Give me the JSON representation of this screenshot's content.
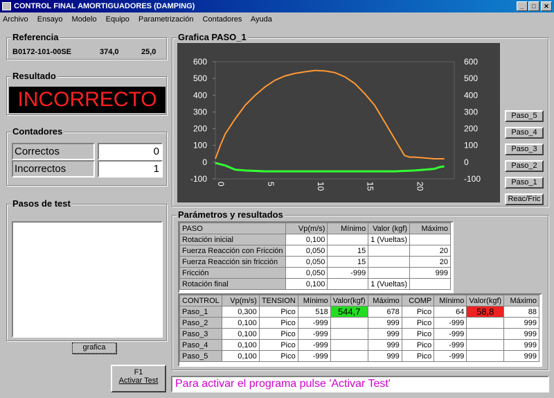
{
  "window": {
    "title": "CONTROL FINAL AMORTIGUADORES (DAMPING)",
    "minimize": "_",
    "maximize": "□",
    "close": "✕"
  },
  "menu": [
    "Archivo",
    "Ensayo",
    "Modelo",
    "Equipo",
    "Parametrización",
    "Contadores",
    "Ayuda"
  ],
  "referencia": {
    "title": "Referencia",
    "code": "B0172-101-00SE",
    "value1": "374,0",
    "value2": "25,0"
  },
  "resultado": {
    "title": "Resultado",
    "text": "INCORRECTO",
    "color": "#ff2020"
  },
  "contadores": {
    "title": "Contadores",
    "rows": [
      {
        "label": "Correctos",
        "value": "0"
      },
      {
        "label": "Incorrectos",
        "value": "1"
      }
    ]
  },
  "pasos": {
    "title": "Pasos de test",
    "grafica_button": "grafica"
  },
  "activar": {
    "key": "F1",
    "label": "Activar Test"
  },
  "status_message": "Para activar el programa pulse 'Activar Test'",
  "grafica": {
    "title": "Grafica PASO_1",
    "buttons": [
      "Paso_5",
      "Paso_4",
      "Paso_3",
      "Paso_2",
      "Paso_1",
      "Reac/Fric"
    ]
  },
  "chart_data": {
    "type": "line",
    "title": "",
    "xlabel": "",
    "ylabel": "",
    "xlim": [
      0,
      24
    ],
    "ylim": [
      -100,
      600
    ],
    "x_ticks": [
      "0",
      "5",
      "10",
      "15",
      "20"
    ],
    "y_ticks": [
      "600",
      "500",
      "400",
      "300",
      "200",
      "100",
      "0",
      "-100"
    ],
    "grid": false,
    "series": [
      {
        "color": "#ff9933",
        "x": [
          0,
          0.5,
          1,
          2,
          3,
          4,
          5,
          6,
          7,
          8,
          9,
          10,
          11,
          12,
          13,
          14,
          15,
          16,
          17,
          18,
          19,
          19.5,
          20,
          21,
          22,
          23
        ],
        "y": [
          20,
          100,
          170,
          260,
          340,
          400,
          450,
          490,
          515,
          530,
          540,
          548,
          545,
          535,
          510,
          470,
          410,
          340,
          240,
          140,
          40,
          30,
          30,
          25,
          20,
          20
        ]
      },
      {
        "color": "#33ff33",
        "x": [
          0,
          1,
          2,
          3,
          5,
          8,
          10,
          13,
          16,
          18,
          20,
          21,
          22,
          22.5,
          23
        ],
        "y": [
          -5,
          -20,
          -45,
          -50,
          -55,
          -55,
          -55,
          -55,
          -55,
          -55,
          -50,
          -45,
          -40,
          -30,
          -25
        ]
      }
    ]
  },
  "params": {
    "title": "Parámetros y resultados",
    "headers": [
      "PASO",
      "Vp(m/s)",
      "Mínimo",
      "Valor (kgf)",
      "Máximo"
    ],
    "rows": [
      [
        "Rotación inicial",
        "0,100",
        "",
        "1 (Vueltas)",
        ""
      ],
      [
        "Fuerza Reacción con Fricción",
        "0,050",
        "15",
        "",
        "20"
      ],
      [
        "Fuerza Reacción sin fricción",
        "0,050",
        "15",
        "",
        "20"
      ],
      [
        "Fricción",
        "0,050",
        "-999",
        "",
        "999"
      ],
      [
        "Rotación final",
        "0,100",
        "",
        "1 (Vueltas)",
        ""
      ]
    ]
  },
  "control": {
    "headers": [
      "CONTROL",
      "Vp(m/s)",
      "TENSION",
      "Mínimo",
      "Valor(kgf)",
      "Máximo",
      "COMP",
      "Mínimo",
      "Valor(kgf)",
      "Máximo"
    ],
    "rows": [
      [
        "Paso_1",
        "0,300",
        "Pico",
        "518",
        "544,7",
        "678",
        "Pico",
        "64",
        "58,8",
        "88"
      ],
      [
        "Paso_2",
        "0,100",
        "Pico",
        "-999",
        "",
        "999",
        "Pico",
        "-999",
        "",
        "999"
      ],
      [
        "Paso_3",
        "0,100",
        "Pico",
        "-999",
        "",
        "999",
        "Pico",
        "-999",
        "",
        "999"
      ],
      [
        "Paso_4",
        "0,100",
        "Pico",
        "-999",
        "",
        "999",
        "Pico",
        "-999",
        "",
        "999"
      ],
      [
        "Paso_5",
        "0,100",
        "Pico",
        "-999",
        "",
        "999",
        "Pico",
        "-999",
        "",
        "999"
      ]
    ],
    "ok_color": "#22dd22",
    "bad_color": "#ee2222"
  }
}
